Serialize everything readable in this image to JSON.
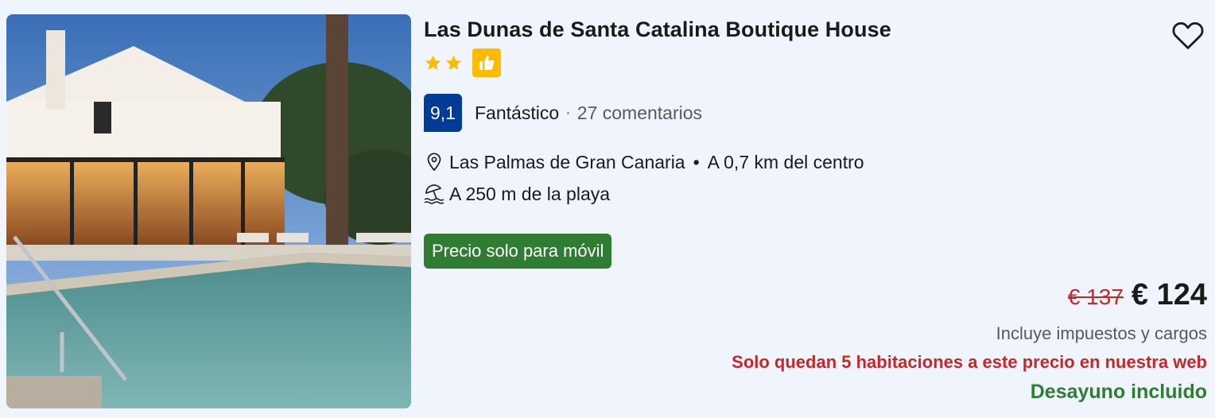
{
  "hotel": {
    "name": "Las Dunas de Santa Catalina Boutique House",
    "stars": 2,
    "score": "9,1",
    "rating_word": "Fantástico",
    "separator": "·",
    "reviews": "27 comentarios",
    "city": "Las Palmas de Gran Canaria",
    "bullet": "•",
    "distance_center": "A 0,7 km del centro",
    "distance_beach": "A 250 m de la playa",
    "mobile_badge": "Precio solo para móvil",
    "old_price": "€ 137",
    "price": "€ 124",
    "taxes_note": "Incluye impuestos y cargos",
    "scarcity_note": "Solo quedan 5 habitaciones a este precio en nuestra web",
    "breakfast_note": "Desayuno incluido"
  },
  "colors": {
    "score_bg": "#003b95",
    "star": "#febb02",
    "old_price": "#c62828",
    "scarcity": "#c62828",
    "badge_bg": "#2e7d32",
    "breakfast": "#2e7d32"
  },
  "icons": {
    "favorite": "heart-outline-icon",
    "star": "star-icon",
    "preferred": "thumbs-up-icon",
    "location": "map-pin-icon",
    "beach": "beach-umbrella-icon"
  }
}
